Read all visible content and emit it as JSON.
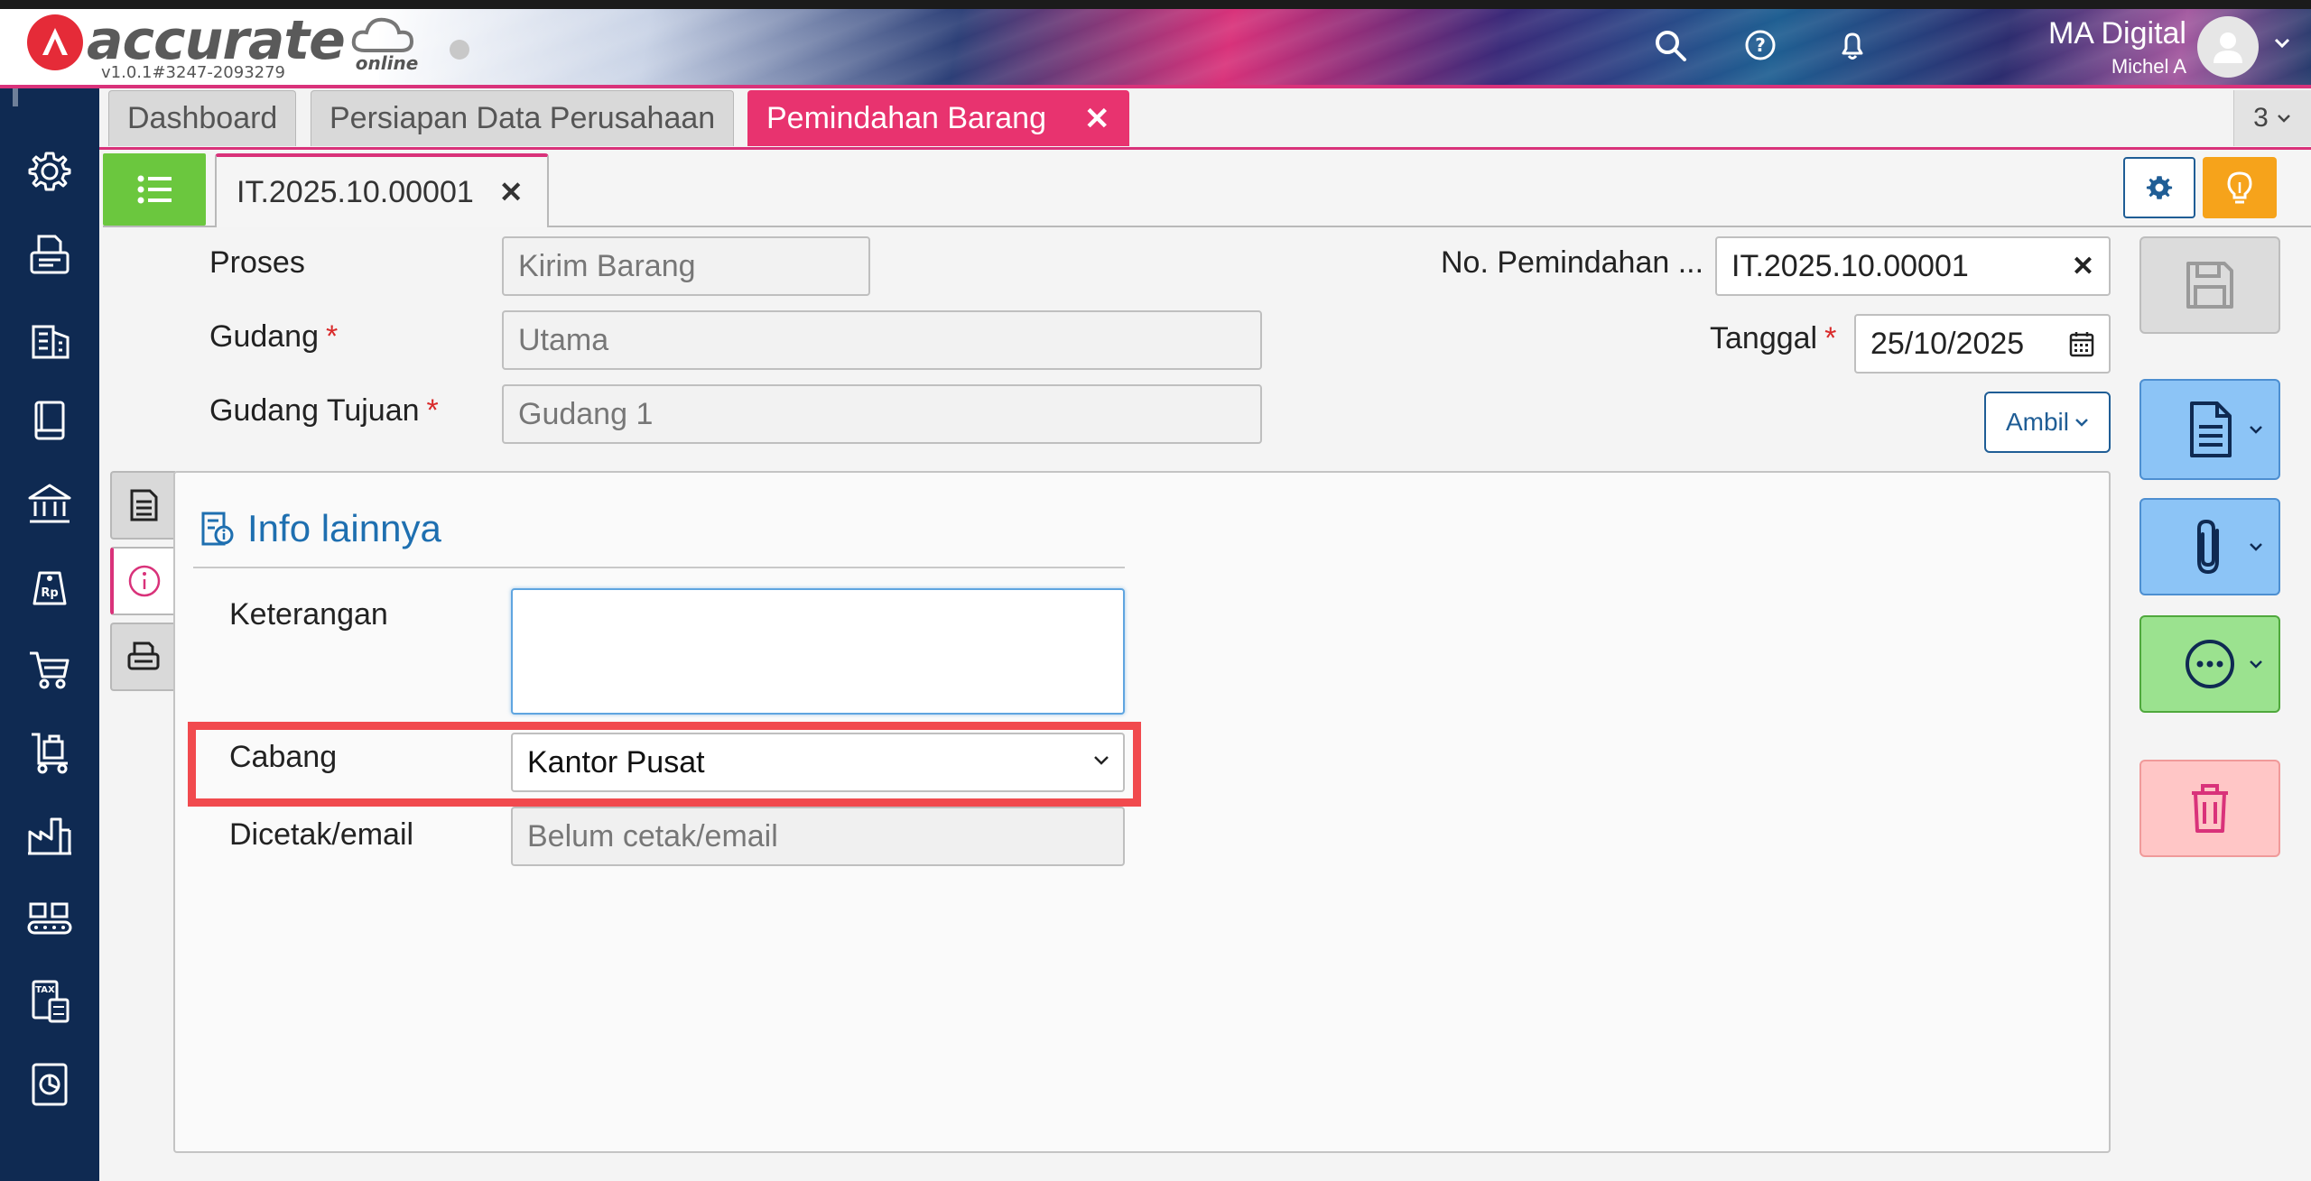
{
  "brand": {
    "logo_text": "accurate",
    "logo_sub": "online",
    "version": "v1.0.1#3247-2093279"
  },
  "header": {
    "company_name": "MA Digital",
    "user_name": "Michel A",
    "icons": [
      "search-icon",
      "help-icon",
      "bell-icon",
      "avatar-icon"
    ]
  },
  "sidebar": {
    "items": [
      "gear-icon",
      "fax-icon",
      "building-icon",
      "book-icon",
      "bank-icon",
      "price-tag-icon",
      "cart-icon",
      "trolley-icon",
      "factory-icon",
      "conveyor-icon",
      "tax-icon",
      "report-icon"
    ]
  },
  "tabs": [
    {
      "label": "Dashboard",
      "active": false
    },
    {
      "label": "Persiapan Data Perusahaan",
      "active": false
    },
    {
      "label": "Pemindahan Barang",
      "active": true,
      "closable": true
    }
  ],
  "tabs_overflow": "3",
  "doc_tab": {
    "label": "IT.2025.10.00001"
  },
  "form": {
    "proses_label": "Proses",
    "proses_value": "Kirim Barang",
    "gudang_label": "Gudang",
    "gudang_value": "Utama",
    "gudang_tujuan_label": "Gudang Tujuan",
    "gudang_tujuan_value": "Gudang 1",
    "no_label": "No. Pemindahan ...",
    "no_value": "IT.2025.10.00001",
    "tanggal_label": "Tanggal",
    "tanggal_value": "25/10/2025",
    "required_mark": "*",
    "ambil_label": "Ambil"
  },
  "panel": {
    "title": "Info lainnya",
    "keterangan_label": "Keterangan",
    "keterangan_value": "",
    "cabang_label": "Cabang",
    "cabang_value": "Kantor Pusat",
    "dicetak_label": "Dicetak/email",
    "dicetak_placeholder": "Belum cetak/email"
  },
  "colors": {
    "accent": "#d9327a",
    "sidebar": "#0f2a52",
    "highlight": "#f14a4e",
    "link": "#1e6fb0"
  }
}
